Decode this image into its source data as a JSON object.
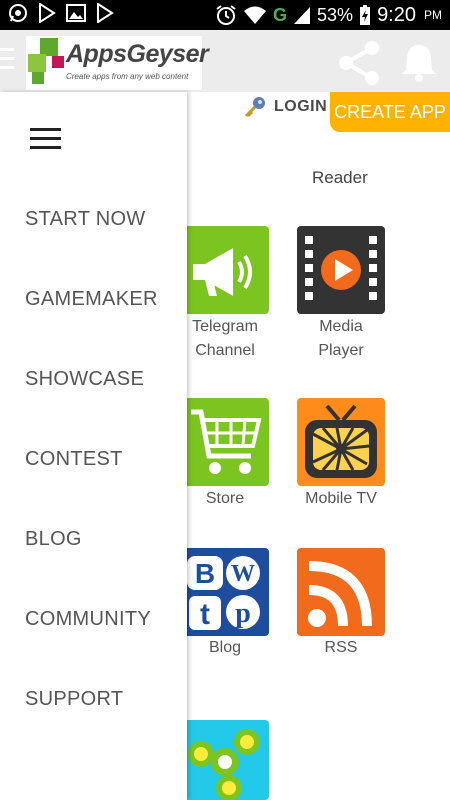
{
  "status_bar": {
    "network_type": "G",
    "battery_percent": "53%",
    "time": "9:20",
    "ampm": "PM"
  },
  "header": {
    "logo_text": "AppsGeyser",
    "logo_tagline": "Create apps from any web content",
    "login_label": "LOGIN",
    "create_app_label": "CREATE APP"
  },
  "drawer": {
    "items": [
      {
        "label": "START NOW"
      },
      {
        "label": "GAMEMAKER"
      },
      {
        "label": "SHOWCASE"
      },
      {
        "label": "CONTEST"
      },
      {
        "label": "BLOG"
      },
      {
        "label": "COMMUNITY"
      },
      {
        "label": "SUPPORT"
      }
    ]
  },
  "grid": {
    "partial_label": "Reader",
    "tiles": [
      {
        "label_line1": "Telegram",
        "label_line2": "Channel",
        "icon": "megaphone-icon",
        "color": "#7cc420"
      },
      {
        "label_line1": "Media",
        "label_line2": "Player",
        "icon": "film-play-icon",
        "color": "#333333"
      },
      {
        "label_line1": "Store",
        "label_line2": "",
        "icon": "shopping-cart-icon",
        "color": "#7cc420"
      },
      {
        "label_line1": "Mobile TV",
        "label_line2": "",
        "icon": "tv-icon",
        "color": "#ff8c1a"
      },
      {
        "label_line1": "Blog",
        "label_line2": "",
        "icon": "blog-social-icon",
        "color": "#1e4d9e"
      },
      {
        "label_line1": "RSS",
        "label_line2": "",
        "icon": "rss-icon",
        "color": "#f26a1b"
      },
      {
        "label_line1": "",
        "label_line2": "",
        "icon": "fidget-spinner-icon",
        "color": "#22c9e8"
      }
    ]
  },
  "colors": {
    "accent_orange": "#ffb300",
    "status_bar": "#000000",
    "appbar": "#ececec"
  }
}
